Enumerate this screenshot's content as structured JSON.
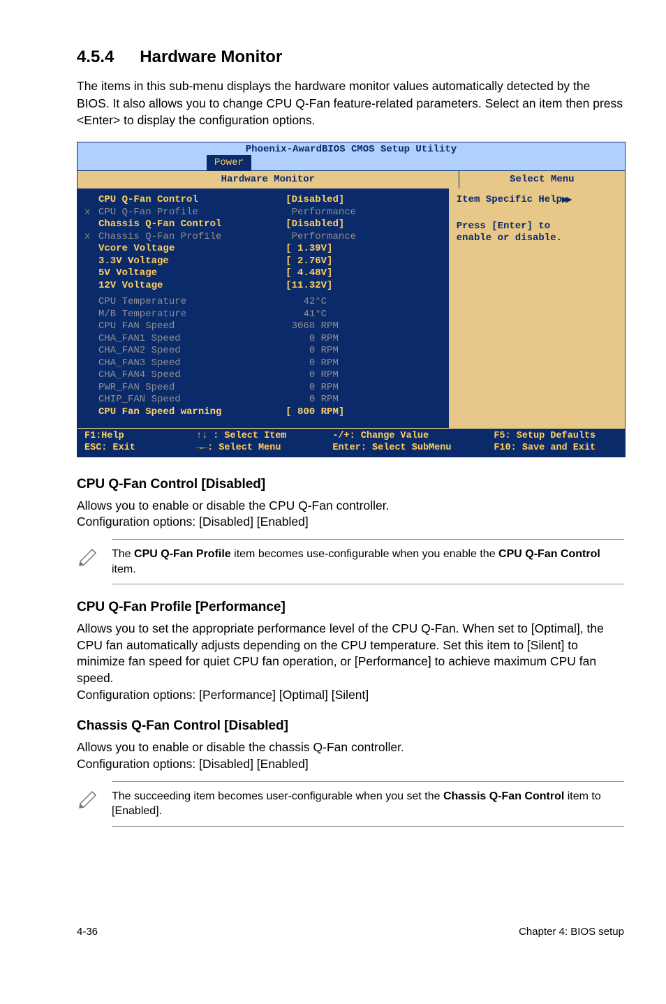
{
  "section": {
    "number": "4.5.4",
    "title": "Hardware Monitor"
  },
  "intro": "The items in this sub-menu displays the hardware monitor values automatically detected by the BIOS. It also allows you to change CPU Q-Fan feature-related parameters. Select an item then press <Enter> to display the configuration options.",
  "bios": {
    "title": "Phoenix-AwardBIOS CMOS Setup Utility",
    "tab": "Power",
    "left_header": "Hardware Monitor",
    "right_header": "Select Menu",
    "help_title": "Item Specific Help",
    "help_arrows": "▶▶",
    "help_body_l1": "Press [Enter] to",
    "help_body_l2": "enable or disable.",
    "rows_top": [
      {
        "prefix": "",
        "label": "CPU Q-Fan Control",
        "value": "[Disabled]",
        "lclass": "yellow",
        "vclass": "yellow"
      },
      {
        "prefix": "x",
        "label": "CPU Q-Fan Profile",
        "value": " Performance",
        "lclass": "gray",
        "vclass": "gray"
      },
      {
        "prefix": "",
        "label": "Chassis Q-Fan Control",
        "value": "[Disabled]",
        "lclass": "yellow",
        "vclass": "yellow"
      },
      {
        "prefix": "x",
        "label": "Chassis Q-Fan Profile",
        "value": " Performance",
        "lclass": "gray",
        "vclass": "gray"
      },
      {
        "prefix": "",
        "label": "Vcore Voltage",
        "value": "[ 1.39V]",
        "lclass": "yellow",
        "vclass": "yellow"
      },
      {
        "prefix": "",
        "label": "3.3V Voltage",
        "value": "[ 2.76V]",
        "lclass": "yellow",
        "vclass": "yellow"
      },
      {
        "prefix": "",
        "label": "5V Voltage",
        "value": "[ 4.48V]",
        "lclass": "yellow",
        "vclass": "yellow"
      },
      {
        "prefix": "",
        "label": "12V Voltage",
        "value": "[11.32V]",
        "lclass": "yellow",
        "vclass": "yellow"
      }
    ],
    "rows_bottom": [
      {
        "prefix": "",
        "label": "CPU Temperature",
        "value": "   42°C",
        "lclass": "gray",
        "vclass": "gray"
      },
      {
        "prefix": "",
        "label": "M/B Temperature",
        "value": "   41°C",
        "lclass": "gray",
        "vclass": "gray"
      },
      {
        "prefix": "",
        "label": "CPU FAN Speed",
        "value": " 3068 RPM",
        "lclass": "gray",
        "vclass": "gray"
      },
      {
        "prefix": "",
        "label": "CHA_FAN1 Speed",
        "value": "    0 RPM",
        "lclass": "gray",
        "vclass": "gray"
      },
      {
        "prefix": "",
        "label": "CHA_FAN2 Speed",
        "value": "    0 RPM",
        "lclass": "gray",
        "vclass": "gray"
      },
      {
        "prefix": "",
        "label": "CHA_FAN3 Speed",
        "value": "    0 RPM",
        "lclass": "gray",
        "vclass": "gray"
      },
      {
        "prefix": "",
        "label": "CHA_FAN4 Speed",
        "value": "    0 RPM",
        "lclass": "gray",
        "vclass": "gray"
      },
      {
        "prefix": "",
        "label": "PWR_FAN Speed",
        "value": "    0 RPM",
        "lclass": "gray",
        "vclass": "gray"
      },
      {
        "prefix": "",
        "label": "CHIP_FAN Speed",
        "value": "    0 RPM",
        "lclass": "gray",
        "vclass": "gray"
      },
      {
        "prefix": "",
        "label": "CPU Fan Speed warning",
        "value": "[ 800 RPM]",
        "lclass": "yellow",
        "vclass": "yellow"
      }
    ],
    "footer": {
      "r1c1": "F1:Help",
      "r1c2": "↑↓ : Select Item",
      "r1c3": "-/+:  Change Value",
      "r1c4": "F5: Setup Defaults",
      "r2c1": "ESC: Exit",
      "r2c2": "→←: Select Menu",
      "r2c3": "Enter: Select SubMenu",
      "r2c4": "F10: Save and Exit"
    }
  },
  "sec1": {
    "heading": "CPU Q-Fan Control [Disabled]",
    "p1": "Allows you to enable or disable the CPU Q-Fan controller.",
    "p2": "Configuration options: [Disabled] [Enabled]"
  },
  "note1": {
    "t1": "The ",
    "b1": "CPU Q-Fan Profile",
    "t2": " item becomes use-configurable when you enable the ",
    "b2": "CPU Q-Fan Control",
    "t3": " item."
  },
  "sec2": {
    "heading": "CPU Q-Fan Profile [Performance]",
    "p1": "Allows you to set the appropriate performance level of the CPU Q-Fan. When set to [Optimal], the CPU fan automatically adjusts depending on the CPU temperature. Set this item to [Silent] to minimize fan speed for quiet CPU fan operation, or [Performance] to achieve maximum CPU fan speed.",
    "p2": "Configuration options: [Performance] [Optimal] [Silent]"
  },
  "sec3": {
    "heading": "Chassis Q-Fan Control [Disabled]",
    "p1": "Allows you to enable or disable the chassis Q-Fan controller.",
    "p2": "Configuration options: [Disabled] [Enabled]"
  },
  "note2": {
    "t1": "The succeeding item becomes user-configurable when you set the ",
    "b1": "Chassis Q-Fan Control",
    "t2": " item to [Enabled]."
  },
  "footer": {
    "left": "4-36",
    "right": "Chapter 4: BIOS setup"
  }
}
